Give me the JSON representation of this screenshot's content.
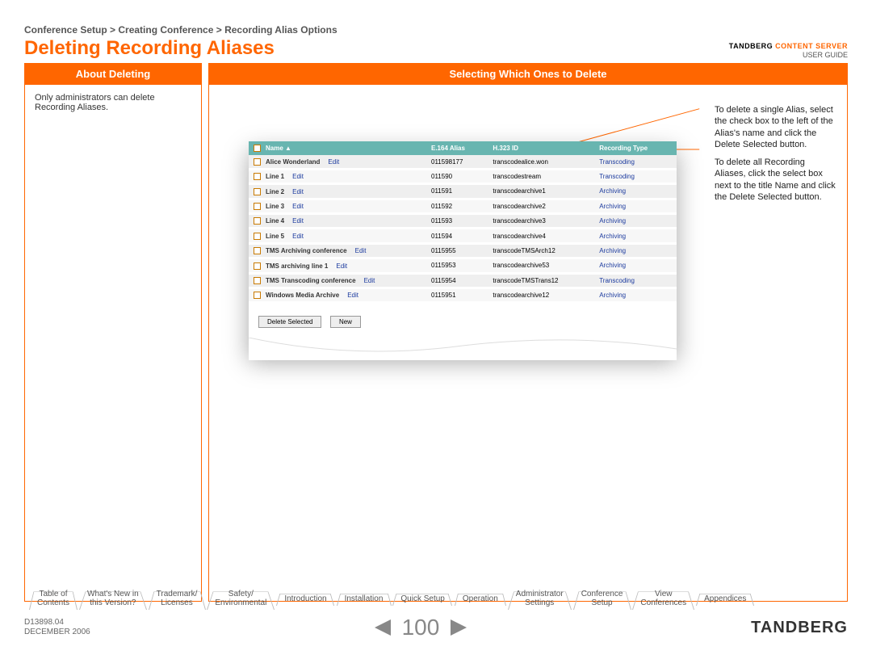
{
  "breadcrumb": "Conference Setup > Creating Conference > Recording Alias Options",
  "page_title": "Deleting Recording Aliases",
  "brand": {
    "line1_a": "TANDBERG",
    "line1_b": "CONTENT SERVER",
    "line2": "USER GUIDE"
  },
  "headers": {
    "left": "About Deleting",
    "right": "Selecting Which Ones to Delete"
  },
  "left_panel_text": "Only administrators can delete Recording Aliases.",
  "right_notes": {
    "p1": "To delete a single Alias, select the check box to the left of the Alias's name and click the Delete Selected button.",
    "p2": "To delete all Recording Aliases, click the select box next to the title Name and click the Delete Selected button."
  },
  "table": {
    "cols": {
      "name": "Name",
      "e164": "E.164 Alias",
      "h323": "H.323 ID",
      "type": "Recording Type"
    },
    "rows": [
      {
        "name": "Alice Wonderland",
        "edit": "Edit",
        "e164": "011598177",
        "h323": "transcodealice.won",
        "type": "Transcoding"
      },
      {
        "name": "Line 1",
        "edit": "Edit",
        "e164": "011590",
        "h323": "transcodestream",
        "type": "Transcoding"
      },
      {
        "name": "Line 2",
        "edit": "Edit",
        "e164": "011591",
        "h323": "transcodearchive1",
        "type": "Archiving"
      },
      {
        "name": "Line 3",
        "edit": "Edit",
        "e164": "011592",
        "h323": "transcodearchive2",
        "type": "Archiving"
      },
      {
        "name": "Line 4",
        "edit": "Edit",
        "e164": "011593",
        "h323": "transcodearchive3",
        "type": "Archiving"
      },
      {
        "name": "Line 5",
        "edit": "Edit",
        "e164": "011594",
        "h323": "transcodearchive4",
        "type": "Archiving"
      },
      {
        "name": "TMS Archiving conference",
        "edit": "Edit",
        "e164": "0115955",
        "h323": "transcodeTMSArch12",
        "type": "Archiving"
      },
      {
        "name": "TMS archiving line 1",
        "edit": "Edit",
        "e164": "0115953",
        "h323": "transcodearchive53",
        "type": "Archiving"
      },
      {
        "name": "TMS Transcoding conference",
        "edit": "Edit",
        "e164": "0115954",
        "h323": "transcodeTMSTrans12",
        "type": "Transcoding"
      },
      {
        "name": "Windows Media Archive",
        "edit": "Edit",
        "e164": "0115951",
        "h323": "transcodearchive12",
        "type": "Archiving"
      }
    ],
    "buttons": {
      "delete_selected": "Delete Selected",
      "new": "New"
    },
    "sort_arrow": "▲"
  },
  "nav_tabs": [
    "Table of\nContents",
    "What's New in\nthis Version?",
    "Trademark/\nLicenses",
    "Safety/\nEnvironmental",
    "Introduction",
    "Installation",
    "Quick Setup",
    "Operation",
    "Administrator\nSettings",
    "Conference\nSetup",
    "View\nConferences",
    "Appendices"
  ],
  "footer": {
    "docid": "D13898.04",
    "date": "DECEMBER 2006",
    "page": "100",
    "logo": "TANDBERG"
  }
}
